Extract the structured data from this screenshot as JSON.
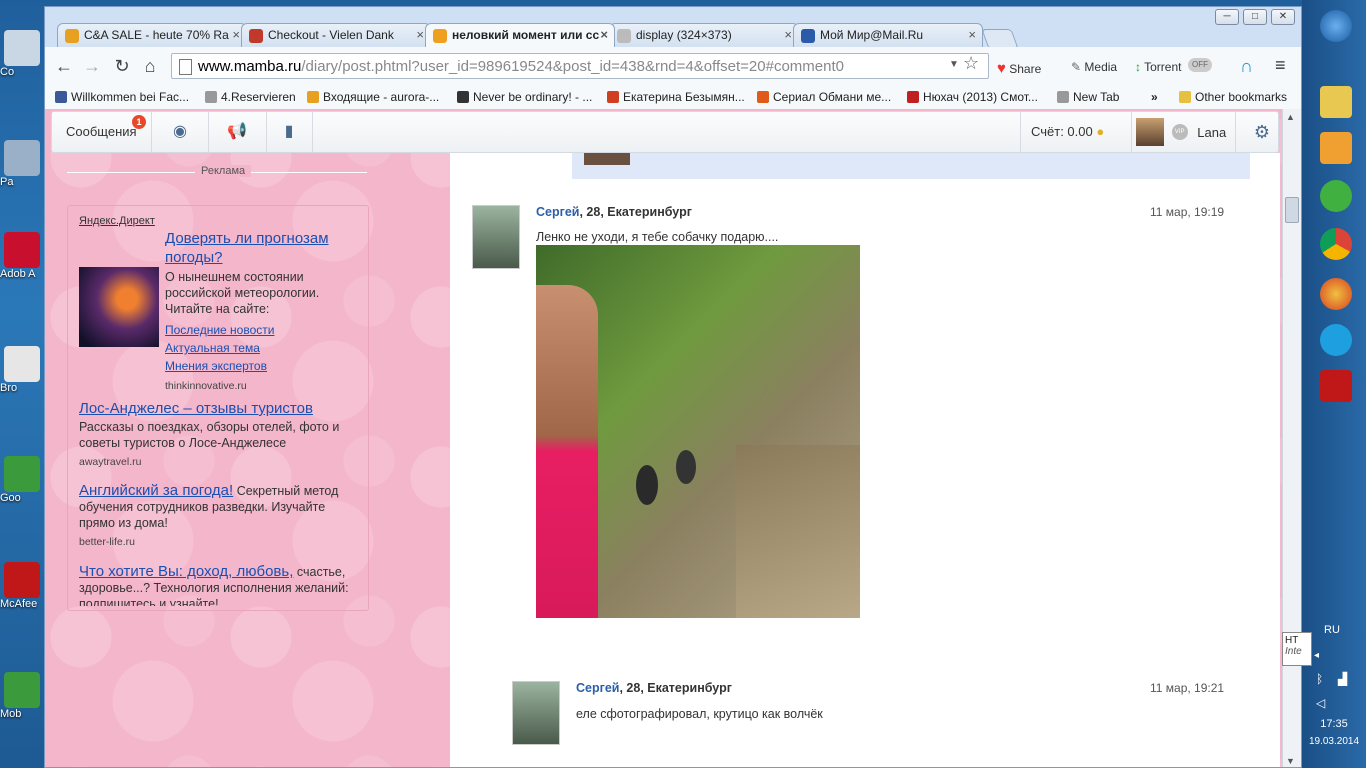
{
  "desktop": {
    "left_labels": [
      "Co",
      "Pa",
      "Adob\nA",
      "Bro",
      "Goo",
      "McAfee",
      "Mob"
    ]
  },
  "window": {
    "controls": [
      "─",
      "□",
      "✕"
    ]
  },
  "tabs": [
    {
      "title": "C&A SALE - heute 70% Ra",
      "favicon_color": "#e8a020",
      "active": false
    },
    {
      "title": "Checkout - Vielen Dank",
      "favicon_color": "#c0392b",
      "active": false
    },
    {
      "title": "неловкий момент или сс",
      "favicon_color": "#f0a020",
      "active": true
    },
    {
      "title": "display (324×373)",
      "favicon_color": "#888888",
      "active": false
    },
    {
      "title": "Мой Мир@Mail.Ru",
      "favicon_color": "#2a5aa8",
      "active": false
    }
  ],
  "toolbar": {
    "url_host": "www.mamba.ru",
    "url_path": "/diary/post.phtml?user_id=989619524&post_id=438&rnd=4&offset=20#comment0",
    "share_label": "Share",
    "media_label": "Media",
    "torrent_label": "Torrent",
    "toggle_label": "OFF"
  },
  "bookmarks": [
    {
      "label": "Willkommen bei Fac...",
      "color": "#3b5998"
    },
    {
      "label": "4.Reservieren",
      "color": "#888888"
    },
    {
      "label": "Входящие - aurora-...",
      "color": "#e8a020"
    },
    {
      "label": "Never be ordinary! - ...",
      "color": "#333333"
    },
    {
      "label": "Екатерина Безымян...",
      "color": "#d04020"
    },
    {
      "label": "Сериал Обмани ме...",
      "color": "#e05a1a"
    },
    {
      "label": "Нюхач (2013) Смот...",
      "color": "#c02020"
    },
    {
      "label": "New Tab",
      "color": "#888888"
    }
  ],
  "bookmarks_overflow": "»",
  "other_bookmarks": "Other bookmarks",
  "mamba": {
    "messages_label": "Сообщения",
    "messages_badge": "1",
    "account_label": "Счёт: 0.00",
    "user_name": "Lana",
    "vip_label": "VIP"
  },
  "ads": {
    "header": "Реклама",
    "provider": "Яндекс.Директ",
    "items": [
      {
        "title": "Доверять ли прогнозам погоды?",
        "body": "О нынешнем состоянии российской метеорологии. Читайте на сайте:",
        "links": [
          "Последние новости",
          "Актуальная тема",
          "Мнения экспертов"
        ],
        "host": "thinkinnovative.ru"
      },
      {
        "title": "Лос-Анджелес – отзывы туристов",
        "body": "Рассказы о поездках, обзоры отелей, фото и советы туристов о Лосе-Анджелесе",
        "host": "awaytravel.ru"
      },
      {
        "title": "Английский за погода!",
        "body": "Секретный метод обучения сотрудников разведки. Изучайте прямо из дома!",
        "host": "better-life.ru"
      },
      {
        "title": "Что хотите Вы: доход, любовь,",
        "body": "счастье, здоровье...? Технология исполнения желаний: подпишитесь и узнайте!"
      }
    ]
  },
  "comments": [
    {
      "author": "Сергей",
      "meta": ", 28, Екатеринбург",
      "date": "11 мар, 19:19",
      "text": "Ленко не уходи, я тебе собачку подарю...."
    },
    {
      "author": "Сергей",
      "meta": ", 28, Екатеринбург",
      "date": "11 мар, 19:21",
      "text": "еле сфотографировал, крутицо как волчёк"
    }
  ],
  "taskbar": {
    "language": "RU",
    "time": "17:35",
    "date": "19.03.2014",
    "tooltip_line1": "HT",
    "tooltip_line2": "Inte"
  }
}
